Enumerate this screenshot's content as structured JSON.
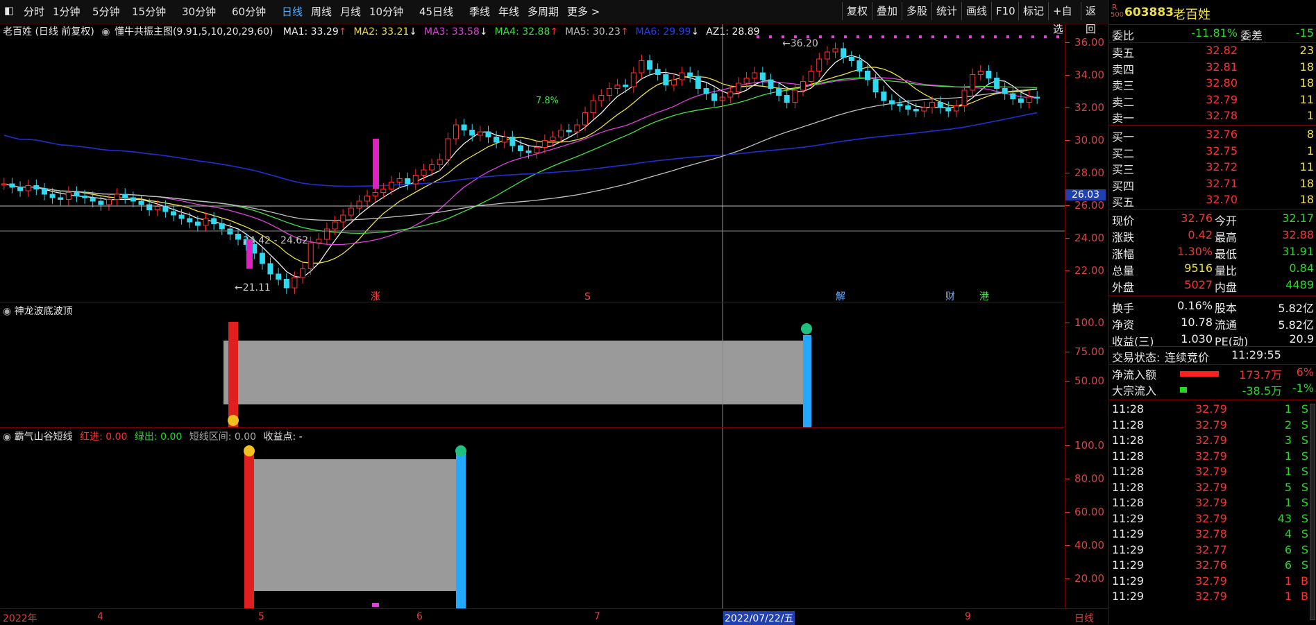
{
  "toolbar": {
    "periods": [
      "分时",
      "1分钟",
      "5分钟",
      "15分钟",
      "30分钟",
      "60分钟",
      "日线",
      "周线",
      "月线",
      "10分钟",
      "45日线",
      "季线",
      "年线",
      "多周期",
      "更多 >"
    ],
    "active_period": "日线",
    "right_buttons": [
      "复权",
      "叠加",
      "多股",
      "统计",
      "画线",
      "F10",
      "标记",
      "+自选",
      "返回"
    ]
  },
  "main_chart": {
    "legend_title": "老百姓 (日线 前复权)",
    "indicator_name": "懂牛共振主图(9.91,5,10,20,29,60)",
    "ma": [
      {
        "label": "MA1: 33.29",
        "arrow": "↑",
        "color": "#f0f0f0"
      },
      {
        "label": "MA2: 33.21",
        "arrow": "↓",
        "color": "#f0e040"
      },
      {
        "label": "MA3: 33.58",
        "arrow": "↓",
        "color": "#e040e0"
      },
      {
        "label": "MA4: 32.88",
        "arrow": "↑",
        "color": "#40e040"
      },
      {
        "label": "MA5: 30.23",
        "arrow": "↑",
        "color": "#c0c0c0"
      },
      {
        "label": "MA6: 29.99",
        "arrow": "↓",
        "color": "#2040ff"
      },
      {
        "label": "AZ1: 28.89",
        "arrow": "",
        "color": "#f0f0f0"
      }
    ],
    "y_ticks": [
      "36.00",
      "34.00",
      "32.00",
      "30.00",
      "28.00",
      "26.00",
      "24.00",
      "22.00"
    ],
    "crosshair_price": "26.03",
    "annotations": {
      "high": "36.20",
      "low": "21.11",
      "range": "24.42 - 24.62",
      "pct": "7.8%"
    },
    "event_marks": [
      "涨",
      "S",
      "解",
      "财",
      "港"
    ]
  },
  "pane2": {
    "title": "神龙波底波顶",
    "y_ticks": [
      "100.0",
      "75.00",
      "50.00"
    ]
  },
  "pane3": {
    "title": "霸气山谷短线",
    "red_label": "红进: 0.00",
    "green_label": "绿出: 0.00",
    "range_label": "短线区间: 0.00",
    "profit_label": "收益点: -",
    "y_ticks": [
      "100.0",
      "80.00",
      "60.00",
      "40.00",
      "20.00"
    ]
  },
  "x_axis": {
    "labels": [
      "2022年",
      "4",
      "5",
      "6",
      "7",
      "2022/07/22/五",
      "9"
    ],
    "period": "日线"
  },
  "quote": {
    "code": "603883",
    "name": "老百姓",
    "badge_r": "R",
    "badge_num": "500",
    "weibi_label": "委比",
    "weibi": "-11.81%",
    "weicha_label": "委差",
    "weicha": "-15",
    "asks": [
      {
        "label": "卖五",
        "price": "32.82",
        "vol": "23"
      },
      {
        "label": "卖四",
        "price": "32.81",
        "vol": "18"
      },
      {
        "label": "卖三",
        "price": "32.80",
        "vol": "18"
      },
      {
        "label": "卖二",
        "price": "32.79",
        "vol": "11"
      },
      {
        "label": "卖一",
        "price": "32.78",
        "vol": "1"
      }
    ],
    "bids": [
      {
        "label": "买一",
        "price": "32.76",
        "vol": "8"
      },
      {
        "label": "买二",
        "price": "32.75",
        "vol": "1"
      },
      {
        "label": "买三",
        "price": "32.72",
        "vol": "11"
      },
      {
        "label": "买四",
        "price": "32.71",
        "vol": "18"
      },
      {
        "label": "买五",
        "price": "32.70",
        "vol": "18"
      }
    ],
    "stats": [
      {
        "l1": "现价",
        "v1": "32.76",
        "c1": "red",
        "l2": "今开",
        "v2": "32.17",
        "c2": "green"
      },
      {
        "l1": "涨跌",
        "v1": "0.42",
        "c1": "red",
        "l2": "最高",
        "v2": "32.88",
        "c2": "red"
      },
      {
        "l1": "涨幅",
        "v1": "1.30%",
        "c1": "red",
        "l2": "最低",
        "v2": "31.91",
        "c2": "green"
      },
      {
        "l1": "总量",
        "v1": "9516",
        "c1": "yellow",
        "l2": "量比",
        "v2": "0.84",
        "c2": "green"
      },
      {
        "l1": "外盘",
        "v1": "5027",
        "c1": "red",
        "l2": "内盘",
        "v2": "4489",
        "c2": "green"
      },
      {
        "l1": "换手",
        "v1": "0.16%",
        "c1": "white",
        "l2": "股本",
        "v2": "5.82亿",
        "c2": "white"
      },
      {
        "l1": "净资",
        "v1": "10.78",
        "c1": "white",
        "l2": "流通",
        "v2": "5.82亿",
        "c2": "white"
      },
      {
        "l1": "收益(三)",
        "v1": "1.030",
        "c1": "white",
        "l2": "PE(动)",
        "v2": "20.9",
        "c2": "white"
      }
    ],
    "trade_status_label": "交易状态:",
    "trade_status": "连续竞价",
    "trade_time": "11:29:55",
    "netflow": {
      "label": "净流入额",
      "value": "173.7万",
      "pct": "6%"
    },
    "blockflow": {
      "label": "大宗流入",
      "value": "-38.5万",
      "pct": "-1%"
    },
    "ticks": [
      {
        "t": "11:28",
        "p": "32.79",
        "v": "1",
        "s": "S"
      },
      {
        "t": "11:28",
        "p": "32.79",
        "v": "2",
        "s": "S"
      },
      {
        "t": "11:28",
        "p": "32.79",
        "v": "3",
        "s": "S"
      },
      {
        "t": "11:28",
        "p": "32.79",
        "v": "1",
        "s": "S"
      },
      {
        "t": "11:28",
        "p": "32.79",
        "v": "1",
        "s": "S"
      },
      {
        "t": "11:28",
        "p": "32.79",
        "v": "5",
        "s": "S"
      },
      {
        "t": "11:28",
        "p": "32.79",
        "v": "1",
        "s": "S"
      },
      {
        "t": "11:29",
        "p": "32.79",
        "v": "43",
        "s": "S"
      },
      {
        "t": "11:29",
        "p": "32.78",
        "v": "4",
        "s": "S"
      },
      {
        "t": "11:29",
        "p": "32.77",
        "v": "6",
        "s": "S"
      },
      {
        "t": "11:29",
        "p": "32.76",
        "v": "6",
        "s": "S"
      },
      {
        "t": "11:29",
        "p": "32.79",
        "v": "1",
        "s": "B"
      },
      {
        "t": "11:29",
        "p": "32.79",
        "v": "1",
        "s": "B"
      }
    ]
  },
  "chart_data": {
    "type": "candlestick",
    "ylim": [
      21,
      37
    ],
    "closes": [
      27.8,
      27.6,
      27.4,
      27.7,
      27.5,
      27.2,
      27.0,
      26.9,
      27.3,
      27.1,
      27.0,
      26.8,
      26.6,
      26.9,
      27.2,
      27.0,
      26.8,
      26.6,
      26.3,
      26.5,
      26.2,
      26.0,
      25.8,
      25.6,
      25.4,
      25.8,
      25.5,
      25.2,
      24.9,
      24.6,
      24.3,
      23.8,
      23.2,
      22.6,
      22.3,
      21.8,
      22.4,
      22.9,
      24.4,
      24.6,
      25.2,
      25.6,
      26.0,
      26.4,
      26.8,
      27.1,
      27.3,
      27.5,
      27.9,
      28.1,
      27.8,
      28.3,
      28.6,
      28.9,
      29.2,
      30.4,
      31.2,
      30.9,
      30.6,
      30.8,
      30.5,
      30.2,
      30.5,
      30.0,
      29.7,
      29.6,
      29.9,
      30.3,
      30.5,
      30.9,
      30.8,
      31.2,
      31.9,
      32.6,
      32.9,
      33.3,
      33.5,
      33.4,
      34.2,
      34.9,
      34.4,
      34.1,
      33.5,
      33.8,
      34.2,
      34.0,
      33.3,
      33.0,
      32.6,
      32.8,
      33.1,
      33.6,
      33.9,
      34.2,
      33.8,
      33.3,
      32.9,
      32.5,
      33.2,
      33.7,
      34.3,
      35.0,
      35.4,
      35.6,
      35.1,
      34.9,
      34.3,
      33.8,
      33.1,
      32.6,
      32.4,
      32.3,
      32.1,
      32.0,
      32.2,
      32.5,
      32.2,
      32.0,
      32.3,
      33.2,
      34.1,
      34.3,
      33.9,
      33.3,
      33.0,
      32.7,
      32.5,
      32.8,
      32.76
    ]
  }
}
